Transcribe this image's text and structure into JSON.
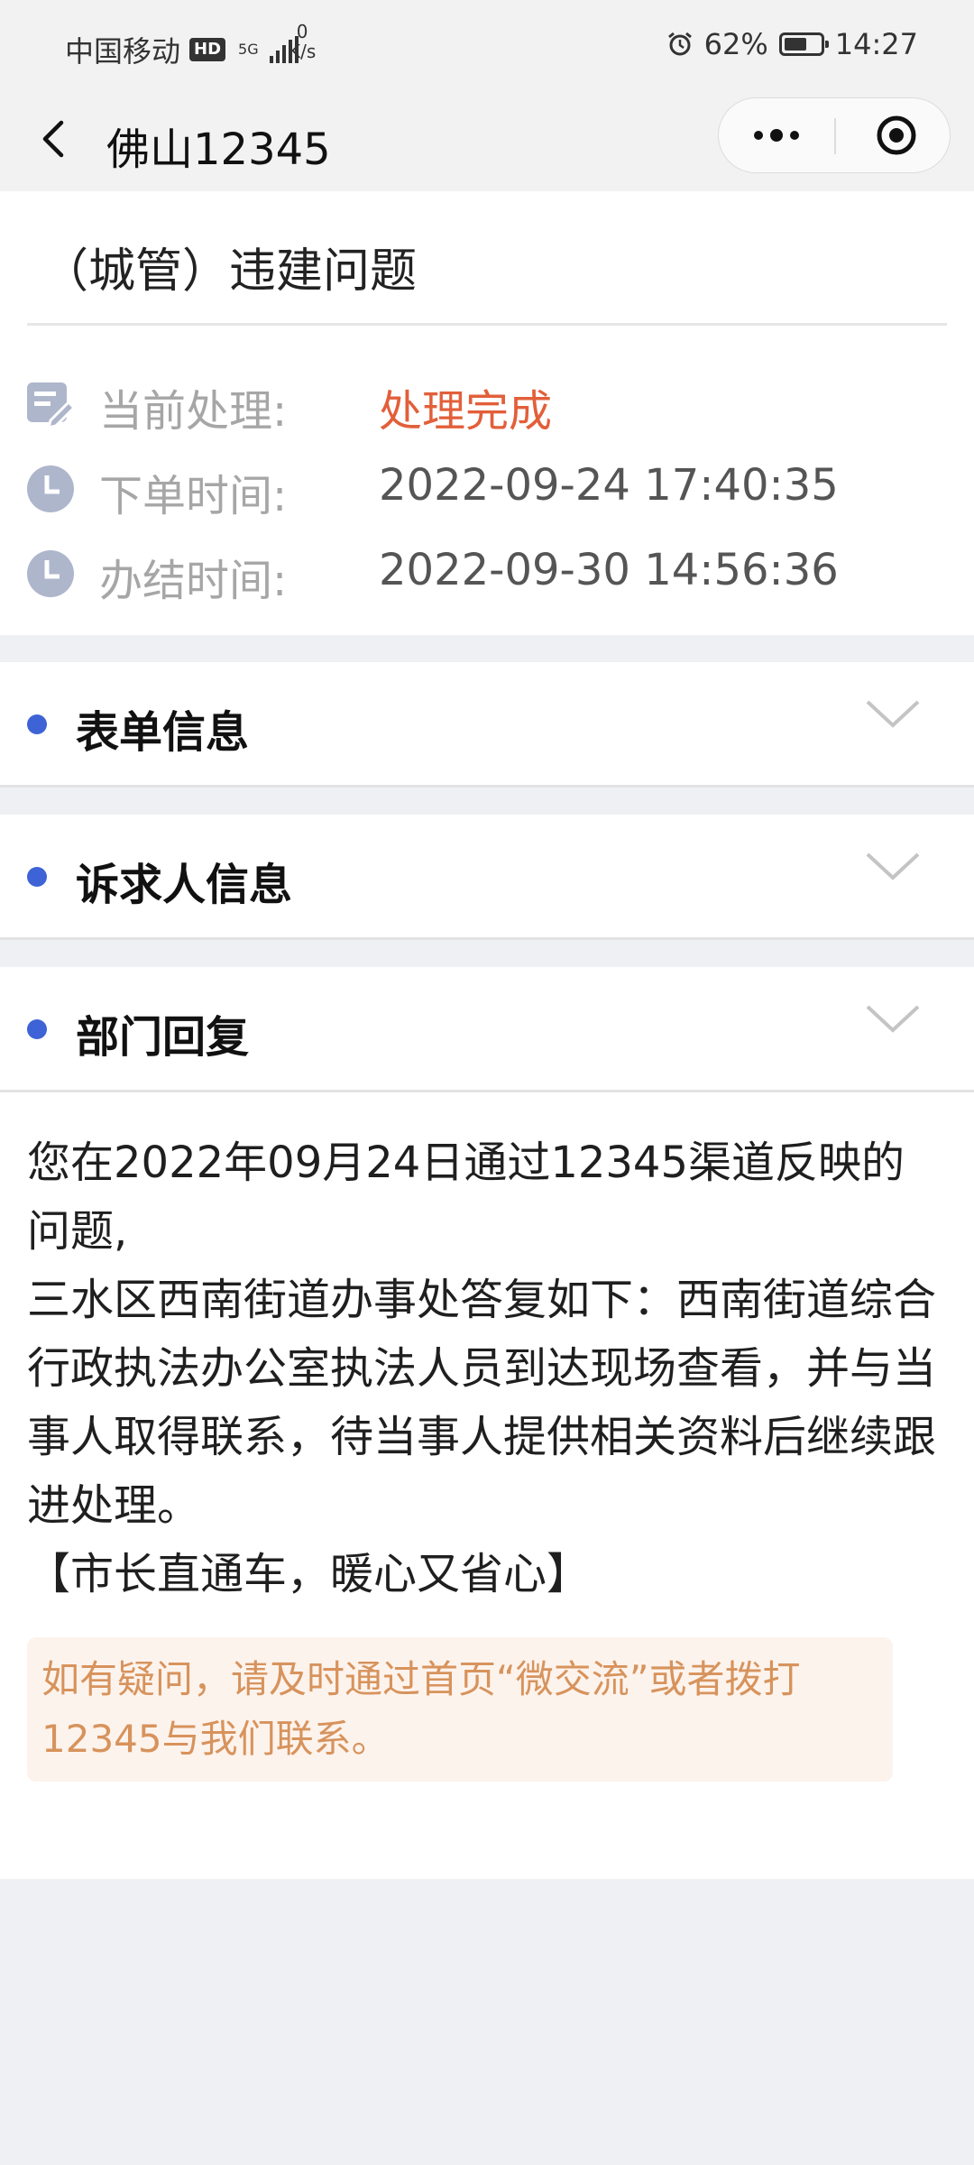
{
  "status_bar": {
    "carrier": "中国移动",
    "hd": "HD",
    "network": "5G",
    "speed_value": "0",
    "speed_unit": "K/s",
    "battery": "62%",
    "battery_level": 0.62,
    "time": "14:27"
  },
  "nav": {
    "title": "佛山12345",
    "icons": [
      "back-chevron-icon",
      "more-dots-icon",
      "close-target-icon"
    ]
  },
  "ticket": {
    "title": "（城管）违建问题",
    "rows": [
      {
        "icon": "edit-note-icon",
        "label": "当前处理:",
        "value": "处理完成"
      },
      {
        "icon": "clock-icon",
        "label": "下单时间:",
        "value": "2022-09-24 17:40:35"
      },
      {
        "icon": "clock-icon",
        "label": "办结时间:",
        "value": "2022-09-30 14:56:36"
      }
    ]
  },
  "sections": [
    {
      "title": "表单信息"
    },
    {
      "title": "诉求人信息"
    },
    {
      "title": "部门回复"
    }
  ],
  "reply": {
    "line1": "您在2022年09月24日通过12345渠道反映的问题,",
    "line2": "三水区西南街道办事处答复如下：西南街道综合行政执法办公室执法人员到达现场查看，并与当事人取得联系，待当事人提供相关资料后继续跟进处理。",
    "line3": "【市长直通车，暖心又省心】",
    "notice": "如有疑问，请及时通过首页“微交流”或者拨打12345与我们联系。"
  },
  "colors": {
    "accent_dot": "#3e63d6",
    "status_done": "#e25f3a",
    "notice_text": "#d7935c",
    "notice_bg": "#fdf3ed"
  }
}
